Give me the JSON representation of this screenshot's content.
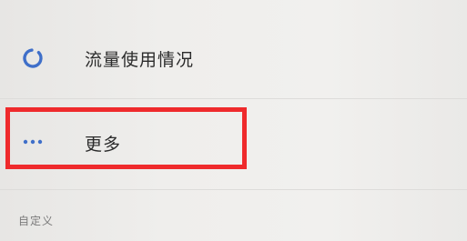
{
  "settings": {
    "items": [
      {
        "label": "流量使用情况",
        "icon": "data-usage-icon"
      },
      {
        "label": "更多",
        "icon": "more-dots-icon"
      }
    ],
    "section_header": "自定义"
  },
  "colors": {
    "accent": "#3f6fc9",
    "highlight": "#ef2a2c",
    "text": "#2b2b2b",
    "subtext": "#7a7a7a",
    "background": "#efeeec"
  }
}
